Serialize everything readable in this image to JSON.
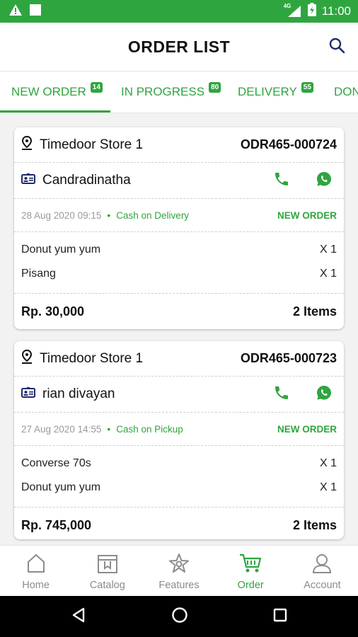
{
  "statusbar": {
    "time": "11:00",
    "network": "4G",
    "icons": [
      "warning-icon",
      "square-icon",
      "signal-icon",
      "battery-icon"
    ]
  },
  "header": {
    "title": "ORDER LIST"
  },
  "tabs": [
    {
      "label": "NEW ORDER",
      "count": "14"
    },
    {
      "label": "IN PROGRESS",
      "count": "80"
    },
    {
      "label": "DELIVERY",
      "count": "55"
    },
    {
      "label": "DON"
    }
  ],
  "orders": [
    {
      "store": "Timedoor Store 1",
      "order_id": "ODR465-000724",
      "customer": "Candradinatha",
      "datetime": "28 Aug 2020 09:15",
      "dot": "•",
      "payment": "Cash on Delivery",
      "status": "NEW ORDER",
      "items": [
        {
          "name": "Donut yum yum",
          "qty": "X 1"
        },
        {
          "name": "Pisang",
          "qty": "X 1"
        }
      ],
      "total": "Rp. 30,000",
      "item_count": "2 Items"
    },
    {
      "store": "Timedoor Store 1",
      "order_id": "ODR465-000723",
      "customer": "rian divayan",
      "datetime": "27 Aug 2020 14:55",
      "dot": "•",
      "payment": "Cash on Pickup",
      "status": "NEW ORDER",
      "items": [
        {
          "name": "Converse 70s",
          "qty": "X 1"
        },
        {
          "name": "Donut yum yum",
          "qty": "X 1"
        }
      ],
      "total": "Rp. 745,000",
      "item_count": "2 Items"
    }
  ],
  "bottom_nav": [
    {
      "label": "Home",
      "icon": "home-icon"
    },
    {
      "label": "Catalog",
      "icon": "catalog-icon"
    },
    {
      "label": "Features",
      "icon": "features-icon"
    },
    {
      "label": "Order",
      "icon": "cart-icon",
      "active": true
    },
    {
      "label": "Account",
      "icon": "account-icon"
    }
  ],
  "colors": {
    "accent": "#2fa53f",
    "statusbar": "#2fa53f",
    "muted": "#9a9a9a"
  }
}
